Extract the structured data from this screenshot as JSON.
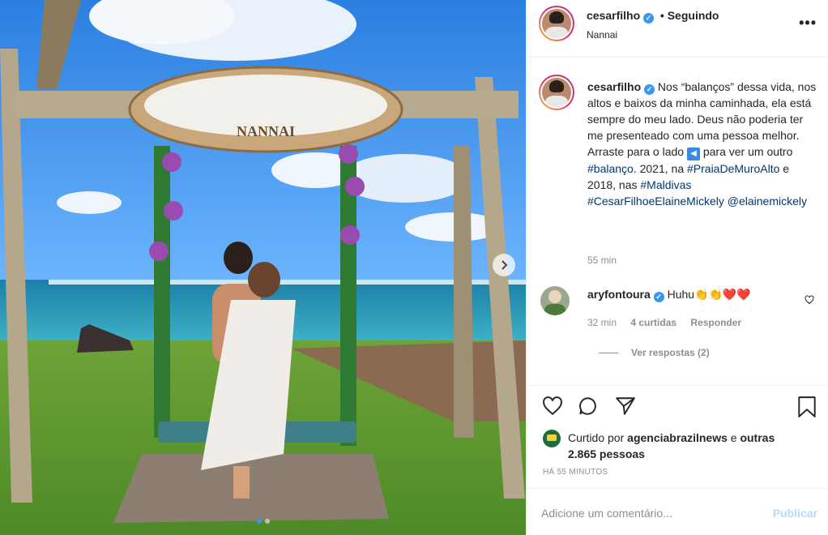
{
  "post": {
    "username": "cesarfilho",
    "follow_status": "• Seguindo",
    "location": "Nannai",
    "more_label": "•••",
    "sign_text": "NANNAI"
  },
  "caption": {
    "username": "cesarfilho",
    "text_1": " Nos “balanços” dessa vida, nos altos e baixos da minha caminhada, ela está sempre do meu lado. Deus não poderia ter me presenteado com uma pessoa melhor. Arraste para o lado ",
    "arrow_glyph": "◀",
    "text_2": " para ver um outro ",
    "tag_balanco": "#balanço",
    "text_3": ". 2021, na ",
    "tag_praia": "#PraiaDeMuroAlto",
    "text_4": " e 2018, nas ",
    "tag_maldivas": "#Maldivas",
    "tag_casal": "#CesarFilhoeElaineMickely",
    "mention": "@elainemickely",
    "time": "55 min"
  },
  "comment": {
    "username": "aryfontoura",
    "text": " Huhu👏👏❤️❤️",
    "time": "32 min",
    "likes": "4 curtidas",
    "reply": "Responder",
    "view_replies": "Ver respostas (2)"
  },
  "likes": {
    "prefix": "Curtido por ",
    "user": "agenciabrazilnews",
    "middle": " e ",
    "others": "outras 2.865 pessoas"
  },
  "posted_ago": "HÁ 55 MINUTOS",
  "add_comment": {
    "placeholder": "Adicione um comentário...",
    "publish": "Publicar"
  },
  "icons": {
    "verified": "verified-badge-icon",
    "like": "heart-icon",
    "comment": "comment-bubble-icon",
    "share": "paper-plane-icon",
    "save": "bookmark-icon",
    "next": "chevron-right-icon"
  },
  "colors": {
    "link": "#00376b",
    "verified": "#3897f0",
    "publish": "#b3dbff",
    "muted": "#8e8e8e"
  }
}
